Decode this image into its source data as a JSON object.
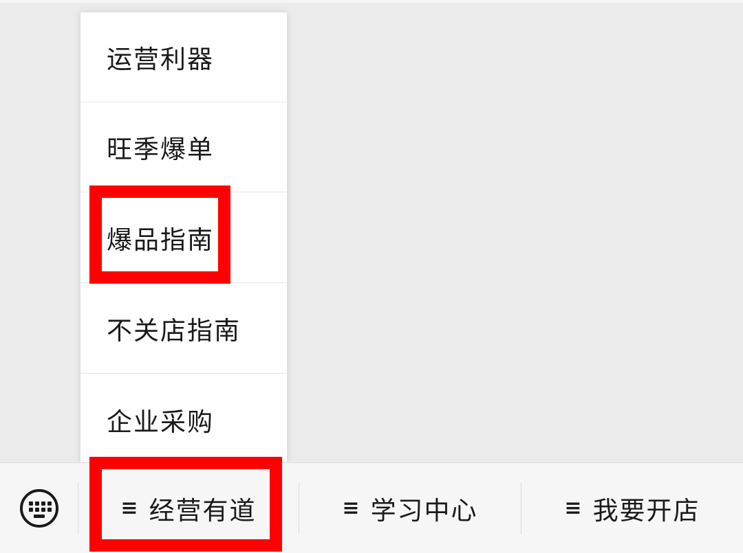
{
  "submenu": {
    "items": [
      {
        "label": "运营利器"
      },
      {
        "label": "旺季爆单"
      },
      {
        "label": "爆品指南"
      },
      {
        "label": "不关店指南"
      },
      {
        "label": "企业采购"
      }
    ]
  },
  "menubar": {
    "keyboard_icon": "keyboard-icon",
    "menu_icon": "hamburger-icon",
    "menu_glyph": "≡",
    "tabs": [
      {
        "label": "经营有道"
      },
      {
        "label": "学习中心"
      },
      {
        "label": "我要开店"
      }
    ]
  },
  "colors": {
    "highlight": "#ff0000",
    "background": "#ebebeb",
    "menubar": "#f6f6f6"
  }
}
